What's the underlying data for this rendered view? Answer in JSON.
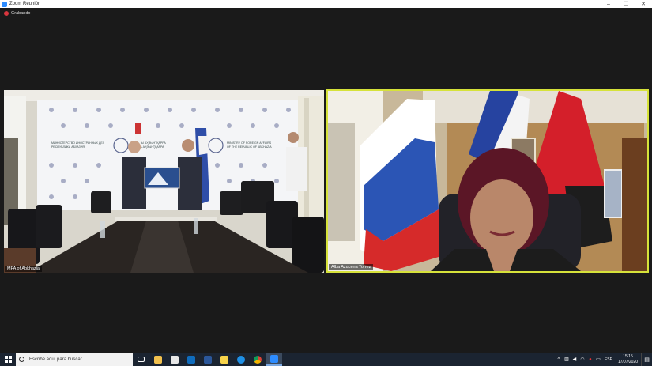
{
  "window": {
    "title": "Zoom Reunión",
    "controls": {
      "minimize": "–",
      "maximize": "☐",
      "close": "✕"
    }
  },
  "recording": {
    "label": "Grabando"
  },
  "participants": [
    {
      "name": "MFA of Abkhazia"
    },
    {
      "name": "Alba Azucena Torrez"
    }
  ],
  "scene_left": {
    "backdrop_text_left": [
      "МИНИСТЕРСТВО ИНОСТРАННЫХ ДЕЛ",
      "РЕСПУБЛИКИ АБХАЗИЯ"
    ],
    "backdrop_text_mid": [
      "АҦСНЫ АҲӘЫНҬҚАРРА",
      "АҴСУА АҲӘЫНҬҚАРРА"
    ],
    "backdrop_text_right": [
      "MINISTRY OF FOREIGN AFFAIRS",
      "OF THE REPUBLIC OF ABKHAZIA"
    ]
  },
  "taskbar": {
    "search_placeholder": "Escribe aquí para buscar",
    "language": "ESP",
    "time": "15:15",
    "date": "17/07/2020"
  },
  "colors": {
    "active_speaker": "#d6e23a",
    "taskbar": "#1b2431",
    "record": "#d9363e"
  }
}
